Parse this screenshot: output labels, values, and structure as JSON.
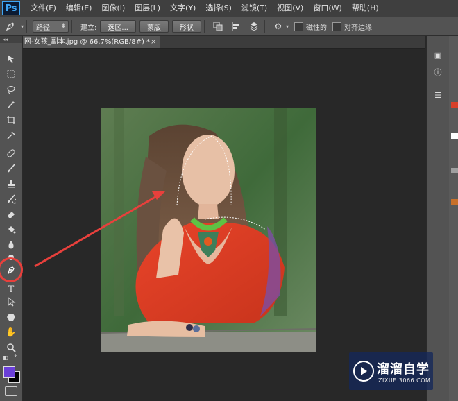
{
  "app": {
    "logo": "Ps",
    "menu": [
      "文件(F)",
      "编辑(E)",
      "图像(I)",
      "图层(L)",
      "文字(Y)",
      "选择(S)",
      "滤镜(T)",
      "视图(V)",
      "窗口(W)",
      "帮助(H)"
    ]
  },
  "options_bar": {
    "mode_select": "路径",
    "make_label": "建立:",
    "buttons": [
      "选区...",
      "蒙版",
      "形状"
    ],
    "rubber_band_label": "磁性的",
    "align_edges_label": "对齐边缘"
  },
  "document": {
    "tab_title": "网-女孩_副本.jpg @ 66.7%(RGB/8#) *",
    "close_glyph": "×"
  },
  "toolbar": {
    "header": "◂◂",
    "active_tool": "pen-tool",
    "foreground_color": "#6a3fd8",
    "background_color": "#000000"
  },
  "annotation": {
    "highlight_color": "#e8403c"
  },
  "watermark": {
    "title": "溜溜自学",
    "url": "ZIXUE.3066.COM"
  }
}
